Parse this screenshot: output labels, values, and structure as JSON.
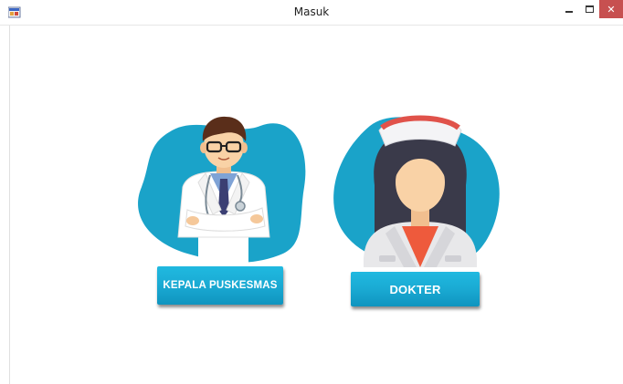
{
  "window": {
    "title": "Masuk",
    "controls": {
      "minimize_icon": "minimize-icon",
      "maximize_icon": "maximize-icon",
      "close_icon": "close-icon",
      "close_glyph": "✕"
    },
    "app_icon": "app-icon"
  },
  "roles": [
    {
      "label": "KEPALA PUSKESMAS",
      "illustration": "doctor-illustration"
    },
    {
      "label": "DOKTER",
      "illustration": "nurse-illustration"
    }
  ],
  "colors": {
    "accent_blue": "#19a6cc",
    "button_blue": "#1aaad3",
    "close_red": "#c75050",
    "skin": "#f9d2a6",
    "nurse_cap_stripe": "#e0524a"
  }
}
